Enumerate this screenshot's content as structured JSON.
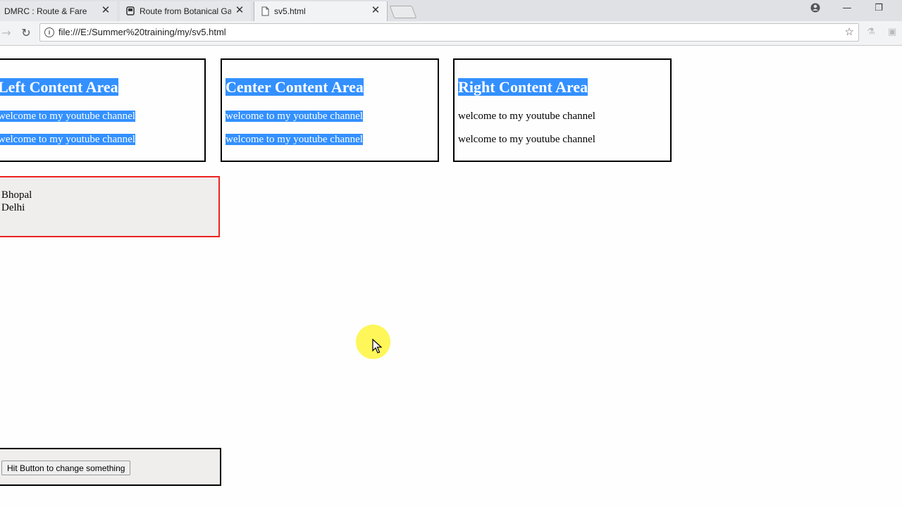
{
  "browser": {
    "tabs": [
      {
        "title": "DMRC : Route & Fare",
        "state": "inactive"
      },
      {
        "title": "Route from Botanical Gar",
        "state": "inactive"
      },
      {
        "title": "sv5.html",
        "state": "active"
      }
    ],
    "url": "file:///E:/Summer%20training/my/sv5.html"
  },
  "content_boxes": {
    "left": {
      "heading": "Left Content Area",
      "line1": "welcome to my youtube channel",
      "line2": "welcome to my youtube channel"
    },
    "center": {
      "heading": "Center Content Area",
      "line1": "welcome to my youtube channel",
      "line2": "welcome to my youtube channel"
    },
    "right": {
      "heading": "Right Content Area",
      "line1": "welcome to my youtube channel",
      "line2": "welcome to my youtube channel"
    }
  },
  "city_list": {
    "options": [
      "Bhopal",
      "Delhi"
    ]
  },
  "action": {
    "button_label": "Hit Button to change something"
  },
  "colors": {
    "selection": "#3390ff",
    "list_border": "#ee2222",
    "cursor_highlight": "#fff43c"
  }
}
